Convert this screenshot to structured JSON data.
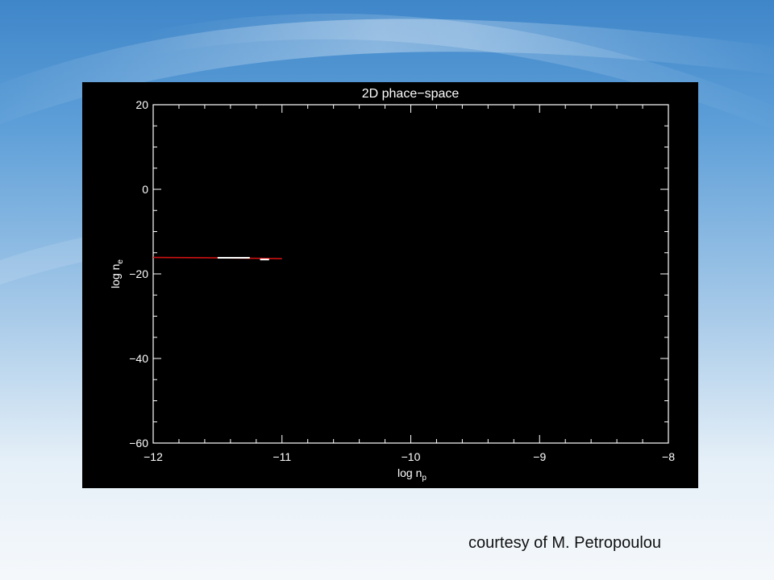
{
  "slide": {
    "credit": "courtesy of M. Petropoulou"
  },
  "colors": {
    "plot_background": "#000000",
    "axes": "#ffffff",
    "curve_red": "#cc1111",
    "curve_white": "#ffffff"
  },
  "chart_data": {
    "type": "line",
    "title": "2D phace−space",
    "xlabel_main": "log n",
    "xlabel_sub": "p",
    "ylabel_main": "log n",
    "ylabel_sub": "e",
    "xlim": [
      -12,
      -8
    ],
    "ylim": [
      -60,
      20
    ],
    "x_ticks": [
      -12,
      -11,
      -10,
      -9,
      -8
    ],
    "x_tick_labels": [
      "−12",
      "−11",
      "−10",
      "−9",
      "−8"
    ],
    "y_ticks": [
      20,
      0,
      -20,
      -40,
      -60
    ],
    "y_tick_labels": [
      "20",
      "0",
      "−20",
      "−40",
      "−60"
    ],
    "grid": false,
    "series": [
      {
        "color": "#cc1111",
        "x": [
          -12.0,
          -11.5,
          -11.0
        ],
        "y": [
          -16.1,
          -16.2,
          -16.4
        ]
      },
      {
        "color": "#ffffff",
        "x": [
          -11.5,
          -11.25
        ],
        "y": [
          -16.2,
          -16.2
        ]
      },
      {
        "color": "#ffffff",
        "x": [
          -11.17,
          -11.1
        ],
        "y": [
          -16.6,
          -16.6
        ]
      }
    ]
  }
}
